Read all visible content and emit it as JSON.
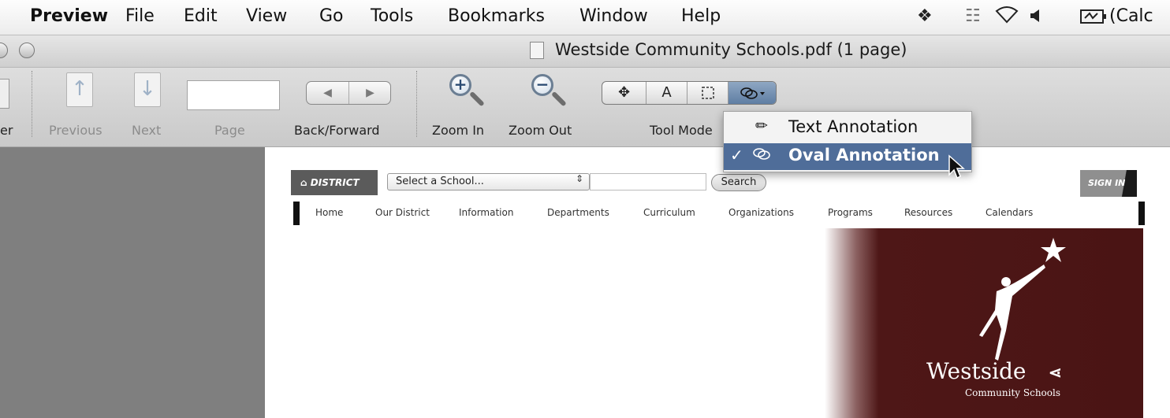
{
  "menubar": {
    "app_name": "Preview",
    "items": [
      "File",
      "Edit",
      "View",
      "Go",
      "Tools",
      "Bookmarks",
      "Window",
      "Help"
    ],
    "status_text": "(Calc"
  },
  "window": {
    "title": "Westside Community Schools.pdf (1 page)"
  },
  "toolbar": {
    "partial_label": "er",
    "previous_label": "Previous",
    "next_label": "Next",
    "page_label": "Page",
    "backforward_label": "Back/Forward",
    "zoom_in_label": "Zoom In",
    "zoom_out_label": "Zoom Out",
    "tool_mode_label": "Tool Mode",
    "tool_mode_text_glyph": "A"
  },
  "dropdown": {
    "items": [
      {
        "label": "Text Annotation",
        "icon": "pencil-icon",
        "checked": false
      },
      {
        "label": "Oval Annotation",
        "icon": "oval-annotation-icon",
        "checked": true
      }
    ],
    "check_glyph": "✓"
  },
  "webpage": {
    "district_label": "DISTRICT",
    "school_select_value": "Select a School...",
    "search_label": "Search",
    "signin_label": "SIGN IN",
    "nav": [
      "Home",
      "Our District",
      "Information",
      "Departments",
      "Curriculum",
      "Organizations",
      "Programs",
      "Resources",
      "Calendars"
    ],
    "logo_text": "Westside",
    "logo_subtext": "Community Schools"
  },
  "colors": {
    "hero_maroon": "#4a1414",
    "menu_highlight": "#4f6d99"
  }
}
